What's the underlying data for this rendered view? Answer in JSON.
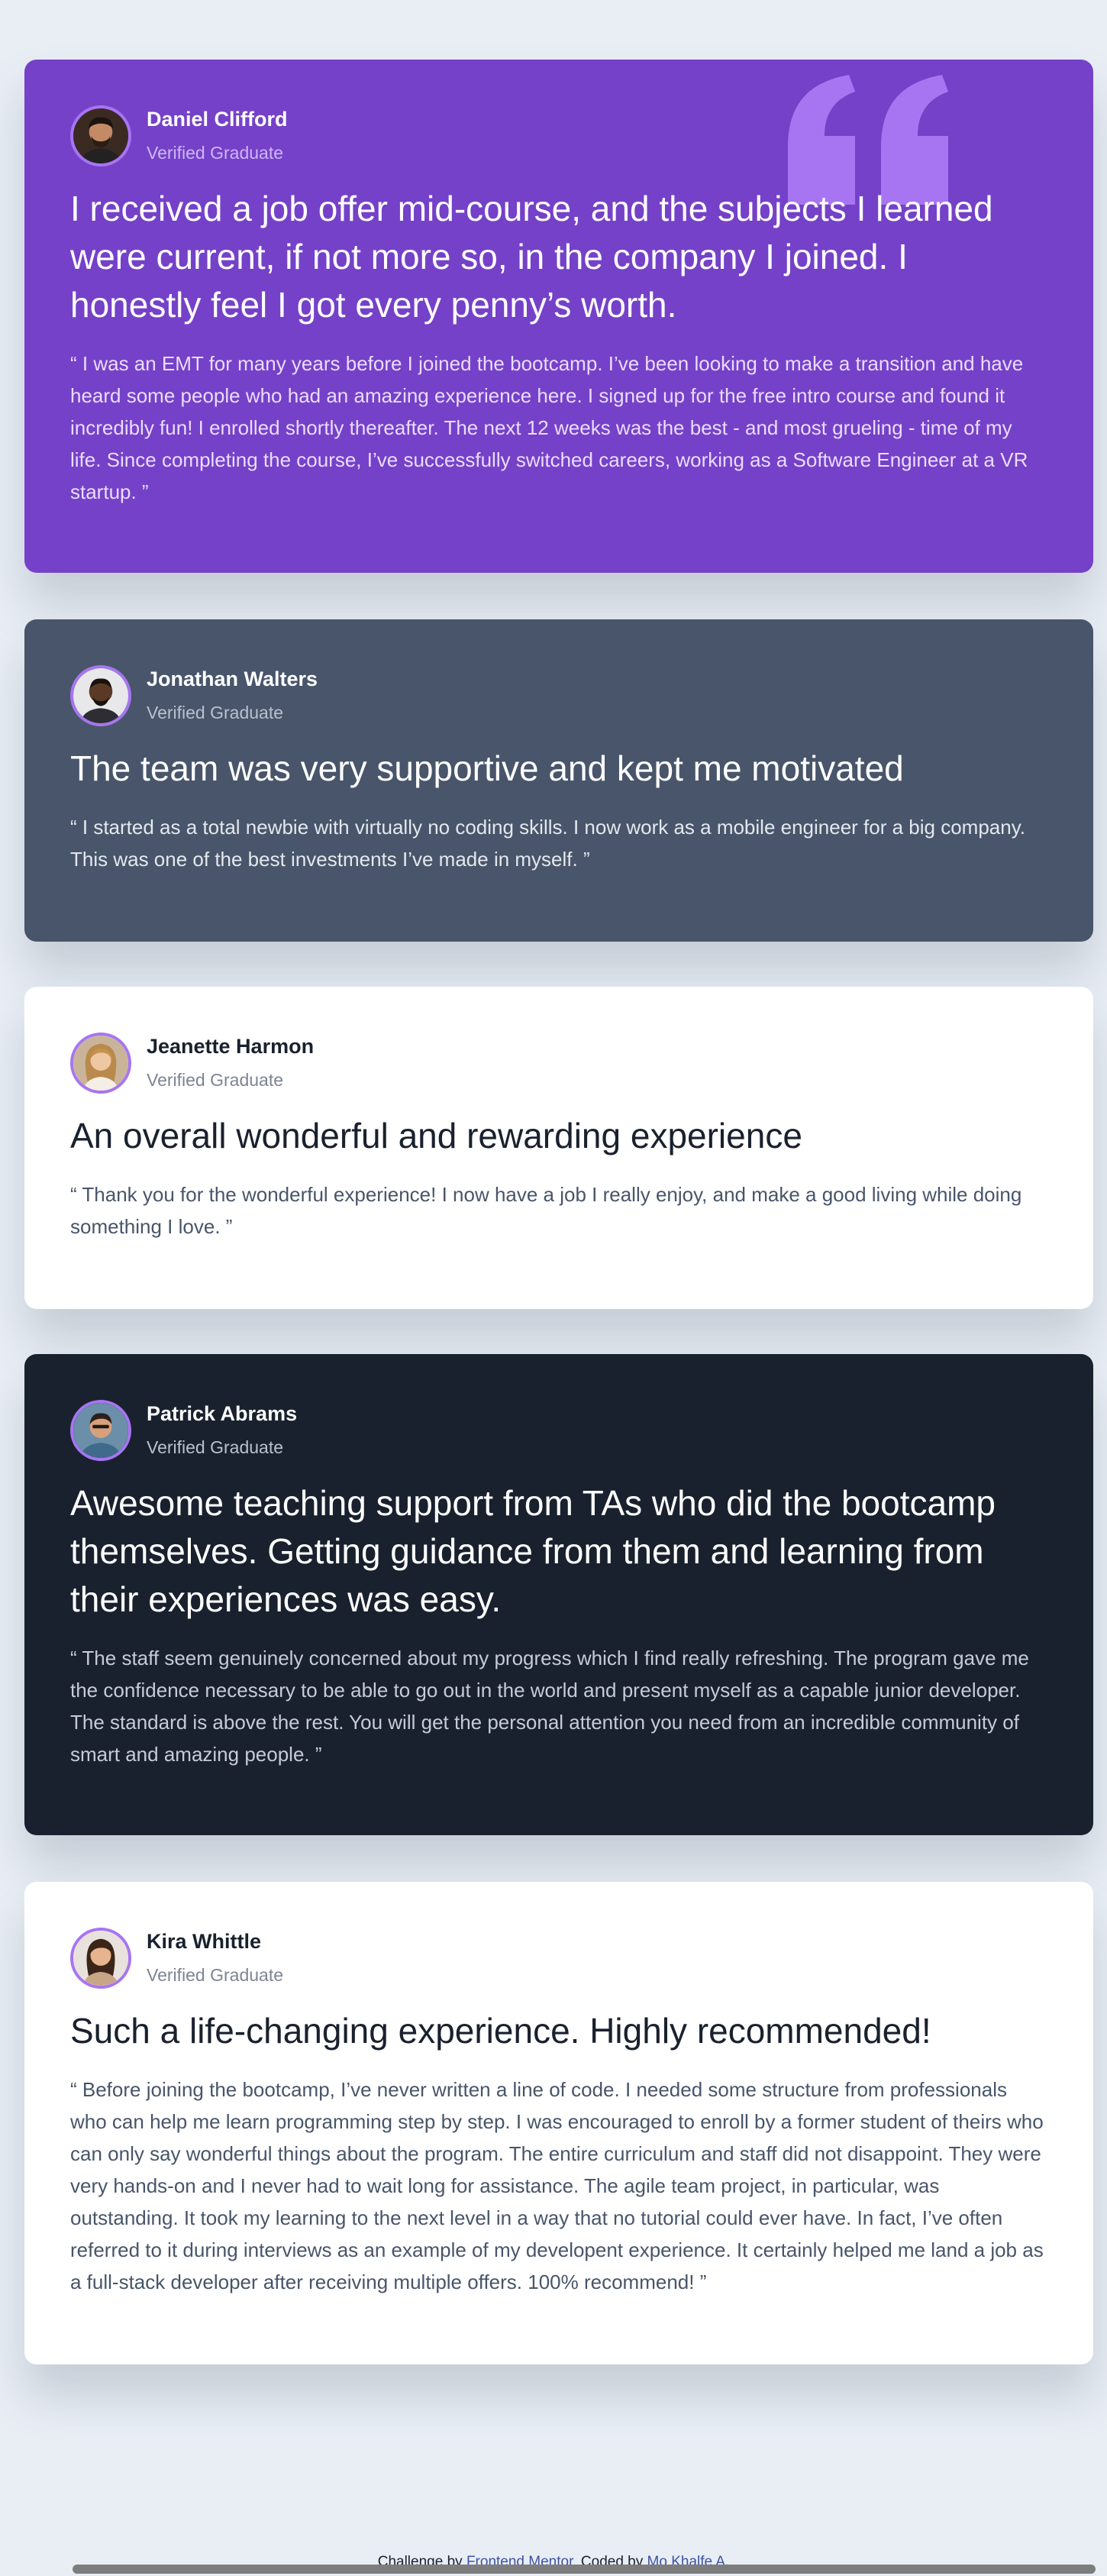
{
  "colors": {
    "page_background": "#e9eef5",
    "purple": "#7541c8",
    "slate": "#48556a",
    "white": "#ffffff",
    "dark": "#19212e",
    "avatar_ring": "#a775f1",
    "quote_mark": "#a775f1"
  },
  "testimonials": [
    {
      "theme": "purple",
      "name": "Daniel Clifford",
      "role": "Verified Graduate",
      "headline": "I received a job offer mid-course, and the subjects I learned were current, if not more so, in the company I joined. I honestly feel I got every penny’s worth.",
      "quote": "“ I was an EMT for many years before I joined the bootcamp. I’ve been looking to make a transition and have heard some people who had an amazing experience here. I signed up for the free intro course and found it incredibly fun! I enrolled shortly thereafter. The next 12 weeks was the best - and most grueling - time of my life. Since completing the course, I’ve successfully switched careers, working as a Software Engineer at a VR startup. ”",
      "avatar_icon": "avatar-man-beard"
    },
    {
      "theme": "slate",
      "name": "Jonathan Walters",
      "role": "Verified Graduate",
      "headline": "The team was very supportive and kept me motivated",
      "quote": "“ I started as a total newbie with virtually no coding skills. I now work as a mobile engineer for a big company. This was one of the best investments I’ve made in myself. ”",
      "avatar_icon": "avatar-man-dark"
    },
    {
      "theme": "white",
      "name": "Jeanette Harmon",
      "role": "Verified Graduate",
      "headline": "An overall wonderful and rewarding experience",
      "quote": "“ Thank you for the wonderful experience! I now have a job I really enjoy, and make a good living while doing something I love. ”",
      "avatar_icon": "avatar-woman-blonde"
    },
    {
      "theme": "dark",
      "name": "Patrick Abrams",
      "role": "Verified Graduate",
      "headline": "Awesome teaching support from TAs who did the bootcamp themselves. Getting guidance from them and learning from their experiences was easy.",
      "quote": "“ The staff seem genuinely concerned about my progress which I find really refreshing. The program gave me the confidence necessary to be able to go out in the world and present myself as a capable junior developer. The standard is above the rest. You will get the personal attention you need from an incredible community of smart and amazing people. ”",
      "avatar_icon": "avatar-man-outdoor"
    },
    {
      "theme": "white",
      "name": "Kira Whittle",
      "role": "Verified Graduate",
      "headline": "Such a life-changing experience. Highly recommended!",
      "quote": "“ Before joining the bootcamp, I’ve never written a line of code. I needed some structure from professionals who can help me learn programming step by step. I was encouraged to enroll by a former student of theirs who can only say wonderful things about the program. The entire curriculum and staff did not disappoint. They were very hands-on and I never had to wait long for assistance. The agile team project, in particular, was outstanding. It took my learning to the next level in a way that no tutorial could ever have. In fact, I’ve often referred to it during interviews as an example of my developent experience. It certainly helped me land a job as a full-stack developer after receiving multiple offers. 100% recommend! ”",
      "avatar_icon": "avatar-woman-brunette"
    }
  ],
  "attribution": {
    "prefix": "Challenge by ",
    "link1": "Frontend Mentor",
    "middle": ". Coded by ",
    "link2": "Mo Khalfe A",
    "suffix": "."
  }
}
